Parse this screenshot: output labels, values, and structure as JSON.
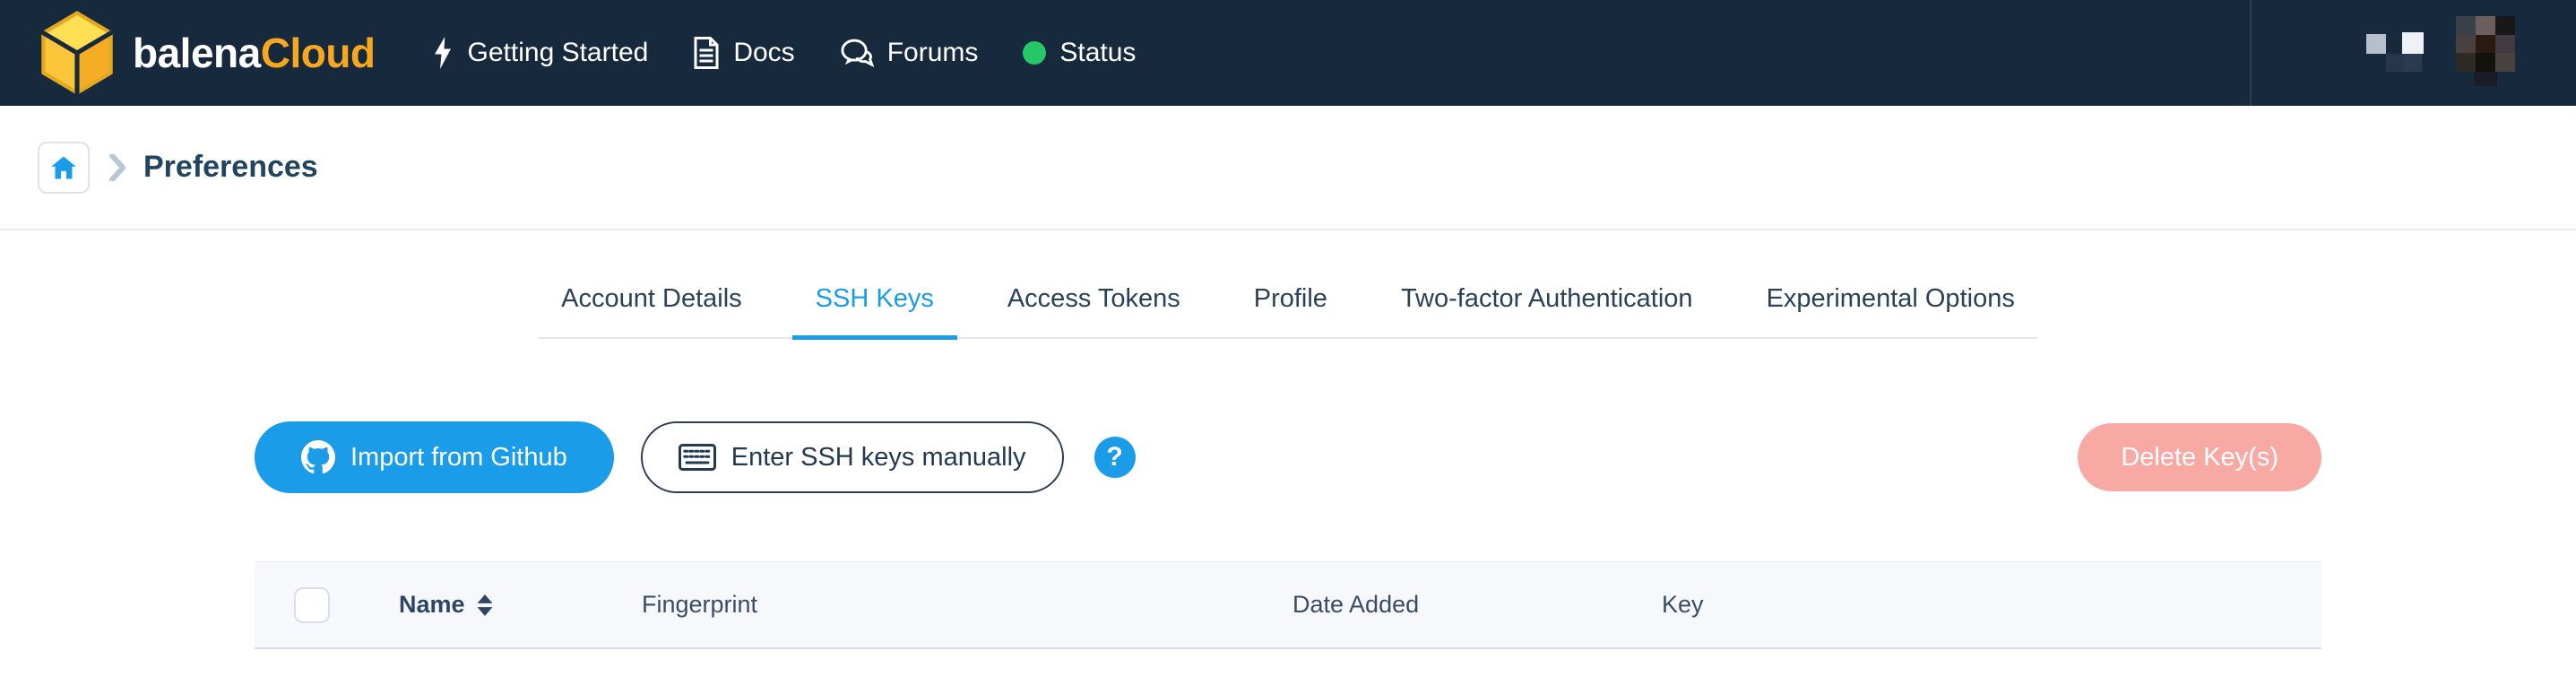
{
  "navbar": {
    "brand": {
      "primary": "balena",
      "secondary": "Cloud"
    },
    "links": [
      {
        "label": "Getting Started",
        "icon": "lightning-icon"
      },
      {
        "label": "Docs",
        "icon": "docs-icon"
      },
      {
        "label": "Forums",
        "icon": "forums-icon"
      },
      {
        "label": "Status",
        "icon": "status-dot-icon"
      }
    ]
  },
  "breadcrumb": {
    "current": "Preferences"
  },
  "tabs": [
    {
      "label": "Account Details",
      "active": false
    },
    {
      "label": "SSH Keys",
      "active": true
    },
    {
      "label": "Access Tokens",
      "active": false
    },
    {
      "label": "Profile",
      "active": false
    },
    {
      "label": "Two-factor Authentication",
      "active": false
    },
    {
      "label": "Experimental Options",
      "active": false
    }
  ],
  "toolbar": {
    "import_github_label": "Import from Github",
    "enter_ssh_label": "Enter SSH keys manually",
    "help_label": "?",
    "delete_label": "Delete Key(s)"
  },
  "table": {
    "columns": [
      "Name",
      "Fingerprint",
      "Date Added",
      "Key"
    ],
    "rows": []
  },
  "colors": {
    "navbar_bg": "#17293d",
    "accent_blue": "#1a9ce9",
    "brand_yellow": "#f8a81e",
    "status_green": "#26c767",
    "delete_pink": "#f9a9a4",
    "table_header_bg": "#f7f8fc",
    "dark_text": "#23445e"
  }
}
